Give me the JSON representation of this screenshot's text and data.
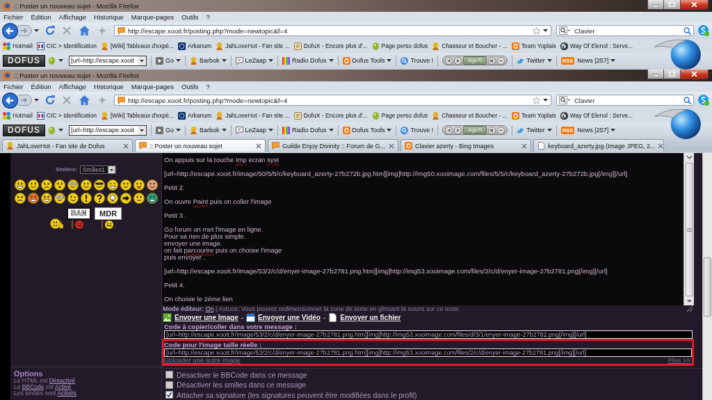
{
  "windows": [
    {
      "title": ":: Poster un nouveau sujet - Mozilla Firefox",
      "menu": [
        "Fichier",
        "Édition",
        "Affichage",
        "Historique",
        "Marque-pages",
        "Outils",
        "?"
      ],
      "url": "http://escape.xooit.fr/posting.php?mode=newtopic&f=4",
      "search": "Clavier",
      "bookmarks": [
        "Hotmail",
        "CIC > Identification",
        "[Wiki] Tableaux d'expé...",
        "Arkanum",
        "JahLoveHot - Fan site ...",
        "DofuX - Encore plus d'...",
        "Page perso dofus",
        "Chasseur et Boucher - ...",
        "Team Yoplais",
        "Way Of Elenol : Serve..."
      ],
      "toolbar": {
        "logo": "DOFUS",
        "field": "[url=http://escape.xooit",
        "items": [
          {
            "kind": "button",
            "label": "Go",
            "menu": true
          },
          {
            "kind": "button",
            "label": "Barbok",
            "menu": true
          },
          {
            "kind": "button",
            "label": "LeZaap",
            "menu": true
          },
          {
            "kind": "button",
            "label": "Radio Dofus",
            "menu": true
          },
          {
            "kind": "button",
            "label": "Dofus Tools",
            "menu": true
          },
          {
            "kind": "button",
            "label": "Trouve !",
            "menu": false
          },
          {
            "kind": "player",
            "display": "Ago'R"
          },
          {
            "kind": "button",
            "label": "Twitter",
            "menu": true
          },
          {
            "kind": "button",
            "label": "News [257]",
            "menu": true,
            "badge": "RSS"
          }
        ]
      }
    },
    {
      "title": ":: Poster un nouveau sujet - Mozilla Firefox",
      "menu": [
        "Fichier",
        "Édition",
        "Affichage",
        "Historique",
        "Marque-pages",
        "Outils",
        "?"
      ],
      "url": "http://escape.xooit.fr/posting.php?mode=newtopic&f=4",
      "search": "Clavier",
      "bookmarks": [
        "Hotmail",
        "CIC > Identification",
        "[Wiki] Tableaux d'expé...",
        "Arkanum",
        "JahLoveHot - Fan site ...",
        "DofuX - Encore plus d'...",
        "Page perso dofus",
        "Chasseur et Boucher - ...",
        "Team Yoplais",
        "Way Of Elenol : Serve..."
      ],
      "toolbar": {
        "logo": "DOFUS",
        "field": "[url=http://escape.xooit",
        "items": [
          {
            "kind": "button",
            "label": "Go",
            "menu": true
          },
          {
            "kind": "button",
            "label": "Barbok",
            "menu": true
          },
          {
            "kind": "button",
            "label": "LeZaap",
            "menu": true
          },
          {
            "kind": "button",
            "label": "Radio Dofus",
            "menu": true
          },
          {
            "kind": "button",
            "label": "Dofus Tools",
            "menu": true
          },
          {
            "kind": "button",
            "label": "Trouve !",
            "menu": false
          },
          {
            "kind": "player",
            "display": "Ago'R"
          },
          {
            "kind": "button",
            "label": "Twitter",
            "menu": true
          },
          {
            "kind": "button",
            "label": "News [257]",
            "menu": true,
            "badge": "RSS"
          }
        ]
      },
      "tabs": [
        {
          "title": "JahLoveHot - Fan site de Dofus",
          "selected": false
        },
        {
          "title": ":: Poster un nouveau sujet",
          "selected": true
        },
        {
          "title": "Guilde Enjoy Divinity :: Forum de G...",
          "selected": false
        },
        {
          "title": "Clavier azerty - Bing Images",
          "selected": false
        },
        {
          "title": "keyboard_azerty.jpg (Image JPEG, 2...",
          "selected": false
        }
      ]
    }
  ],
  "smilies": {
    "label": "Smilies:",
    "select": "Smilies1",
    "signs": [
      "BAN",
      "MDR"
    ]
  },
  "editor": {
    "paragraphs": [
      {
        "lines": [
          {
            "segments": [
              {
                "text": "On appuis sur la touche ",
                "misspelled": false
              },
              {
                "text": "Imp",
                "misspelled": true
              },
              {
                "text": " ecran ",
                "misspelled": false
              },
              {
                "text": "syst",
                "misspelled": true
              }
            ]
          }
        ]
      },
      {
        "lines": [
          {
            "segments": [
              {
                "text": "[url=http://escape.xooit.fr/image/50/5/5/c/keyboard_azerty-27b272b.jpg.htm][img]http://img50.xooimage.com/files/5/5/c/keyboard_azerty-27b272b.jpg[/img][/url]",
                "misspelled": false
              }
            ]
          }
        ]
      },
      {
        "lines": [
          {
            "segments": [
              {
                "text": "Petit 2.",
                "misspelled": false
              }
            ]
          }
        ]
      },
      {
        "lines": [
          {
            "segments": [
              {
                "text": "On ouvre ",
                "misspelled": false
              },
              {
                "text": "Paint",
                "misspelled": true
              },
              {
                "text": " puis on coller l'image",
                "misspelled": false
              }
            ]
          }
        ]
      },
      {
        "lines": [
          {
            "segments": [
              {
                "text": "Petit 3 .",
                "misspelled": false
              }
            ]
          }
        ]
      },
      {
        "lines": [
          {
            "segments": [
              {
                "text": "Go forum on met l'image en ligne.",
                "misspelled": false
              }
            ]
          },
          {
            "segments": [
              {
                "text": "Pour sa rien de plus simple.",
                "misspelled": false
              }
            ]
          },
          {
            "segments": [
              {
                "text": "envoyer une image.",
                "misspelled": false
              }
            ]
          },
          {
            "segments": [
              {
                "text": "on fait ",
                "misspelled": false
              },
              {
                "text": "parcourire",
                "misspelled": true
              },
              {
                "text": " puis on choisie l'image",
                "misspelled": false
              }
            ]
          },
          {
            "segments": [
              {
                "text": "puis envoyer .",
                "misspelled": false
              }
            ]
          }
        ]
      },
      {
        "lines": [
          {
            "segments": [
              {
                "text": "[url=http://escape.xooit.fr/image/53/2/c/d/enyer-image-27b2781.png.htm][img]http://img53.xooimage.com/files/2/c/d/enyer-image-27b2781.png[/img][/url]",
                "misspelled": false
              }
            ]
          }
        ]
      },
      {
        "lines": [
          {
            "segments": [
              {
                "text": "Petit 4.",
                "misspelled": false
              }
            ]
          }
        ]
      },
      {
        "lines": [
          {
            "segments": [
              {
                "text": "On choisie le 2éme lien",
                "misspelled": false
              }
            ]
          }
        ]
      }
    ]
  },
  "editor_hint": {
    "label": "Mode éditeur:",
    "link": "On",
    "text": "| Astuce: Vous pouvez redimensionner la zone de texte en glissant la souris sur ce texte."
  },
  "upload_links": [
    {
      "kind": "image",
      "text": "Envoyer une Image"
    },
    {
      "kind": "separator",
      "text": "-"
    },
    {
      "kind": "video",
      "text": "Envoyer une Vidéo"
    },
    {
      "kind": "separator",
      "text": "-"
    },
    {
      "kind": "file",
      "text": "Envoyer un fichier"
    }
  ],
  "code_fields": [
    {
      "label": "Code à copier/coller dans votre message :",
      "value": "[url=http://escape.xooit.fr/image/53/2/c/d/enyer-image-27b2781.png.htm][img]http://img53.xooimage.com/files/d/3/1/enyer-image-27b2782.png[/img][/url]",
      "highlighted": false
    },
    {
      "label": "Code pour l'image taille réelle :",
      "value": "[url=http://escape.xooit.fr/image/53/2/c/d/enyer-image-27b2781.png.htm][img]http://img53.xooimage.com/files/2/c/d/enyer-image-27b2781.png[/img][/url]",
      "highlighted": true
    }
  ],
  "upload_again": "Uploader une autre image",
  "more": "Plus >>",
  "checkboxes": [
    {
      "label": "Désactiver le BBCode dans ce message",
      "checked": false
    },
    {
      "label": "Désactiver les smilies dans ce message",
      "checked": false
    },
    {
      "label": "Attacher sa signature (les signatures peuvent être modifiées dans le profil)",
      "checked": true
    }
  ],
  "options": {
    "title": "Options",
    "lines": [
      {
        "parts": [
          {
            "kind": "text",
            "text": "Le HTML est "
          },
          {
            "kind": "link",
            "text": "Désactivé"
          }
        ]
      },
      {
        "parts": [
          {
            "kind": "text",
            "text": "Le "
          },
          {
            "kind": "link",
            "text": "BBCode"
          },
          {
            "kind": "text",
            "text": " est "
          },
          {
            "kind": "link",
            "text": "Activé"
          }
        ]
      },
      {
        "parts": [
          {
            "kind": "text",
            "text": "Les smilies sont "
          },
          {
            "kind": "link",
            "text": "Activés"
          }
        ]
      }
    ]
  }
}
